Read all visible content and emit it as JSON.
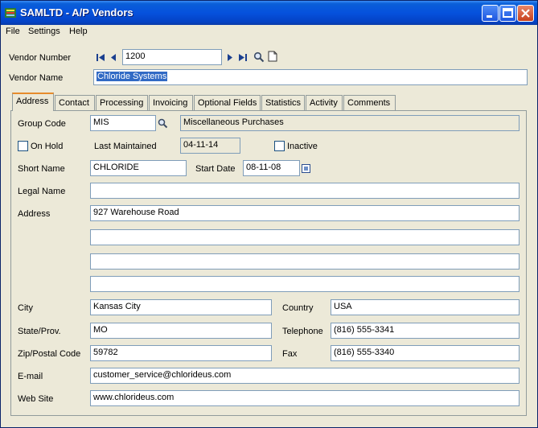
{
  "window": {
    "title": "SAMLTD - A/P Vendors"
  },
  "menu": [
    "File",
    "Settings",
    "Help"
  ],
  "vendor": {
    "number_label": "Vendor Number",
    "number": "1200",
    "name_label": "Vendor Name",
    "name": "Chloride Systems"
  },
  "tabs": [
    "Address",
    "Contact",
    "Processing",
    "Invoicing",
    "Optional Fields",
    "Statistics",
    "Activity",
    "Comments"
  ],
  "address": {
    "group_code_label": "Group Code",
    "group_code": "MIS",
    "group_desc": "Miscellaneous Purchases",
    "on_hold_label": "On Hold",
    "last_maintained_label": "Last Maintained",
    "last_maintained": "04-11-14",
    "inactive_label": "Inactive",
    "short_name_label": "Short Name",
    "short_name": "CHLORIDE",
    "start_date_label": "Start Date",
    "start_date": "08-11-08",
    "legal_name_label": "Legal Name",
    "legal_name": "",
    "address_label": "Address",
    "address_lines": [
      "927 Warehouse Road",
      "",
      "",
      ""
    ],
    "city_label": "City",
    "city": "Kansas City",
    "country_label": "Country",
    "country": "USA",
    "state_label": "State/Prov.",
    "state": "MO",
    "telephone_label": "Telephone",
    "telephone": "(816) 555-3341",
    "zip_label": "Zip/Postal Code",
    "zip": "59782",
    "fax_label": "Fax",
    "fax": "(816) 555-3340",
    "email_label": "E-mail",
    "email": "customer_service@chlorideus.com",
    "website_label": "Web Site",
    "website": "www.chlorideus.com"
  },
  "colors": {
    "titlebar": "#0551DD",
    "selection": "#316AC5",
    "active_tab_accent": "#E68B2C"
  }
}
